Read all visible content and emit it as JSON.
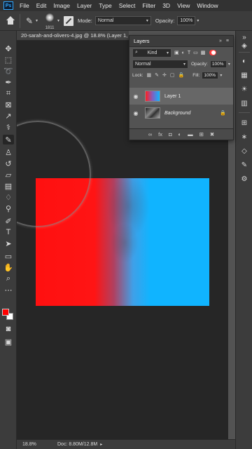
{
  "menubar": {
    "logo": "Ps",
    "items": [
      "File",
      "Edit",
      "Image",
      "Layer",
      "Type",
      "Select",
      "Filter",
      "3D",
      "View",
      "Window"
    ]
  },
  "options": {
    "brush_size": "1811",
    "mode_label": "Mode:",
    "mode_value": "Normal",
    "opacity_label": "Opacity:",
    "opacity_value": "100%"
  },
  "document": {
    "tab_title": "20-sarah-and-olivers-4.jpg @ 18.8% (Layer 1,",
    "canvas_colors": {
      "left": "#ff1414",
      "right": "#10b4ff"
    }
  },
  "status": {
    "zoom": "18.8%",
    "doc_info": "Doc: 8.80M/12.8M"
  },
  "swatches": {
    "foreground": "#ff0000",
    "background": "#ffffff"
  },
  "layers_panel": {
    "tab": "Layers",
    "filter_value": "Kind",
    "blend_mode": "Normal",
    "opacity_label": "Opacity:",
    "opacity_value": "100%",
    "lock_label": "Lock:",
    "fill_label": "Fill:",
    "fill_value": "100%",
    "layers": [
      {
        "name": "Layer 1",
        "selected": true,
        "locked": false
      },
      {
        "name": "Background",
        "selected": false,
        "locked": true
      }
    ],
    "footer_icons": [
      "link-icon",
      "fx-icon",
      "mask-icon",
      "adjustment-icon",
      "group-icon",
      "new-layer-icon",
      "trash-icon"
    ]
  },
  "tools": [
    "move-tool",
    "marquee-tool",
    "lasso-tool",
    "quick-select-tool",
    "crop-tool",
    "frame-tool",
    "eyedropper-tool",
    "healing-brush-tool",
    "brush-tool",
    "clone-stamp-tool",
    "history-brush-tool",
    "eraser-tool",
    "gradient-tool",
    "blur-tool",
    "dodge-tool",
    "pen-tool",
    "type-tool",
    "path-selection-tool",
    "rectangle-tool",
    "hand-tool",
    "zoom-tool",
    "more-tools",
    "quick-mask",
    "screen-mode"
  ]
}
